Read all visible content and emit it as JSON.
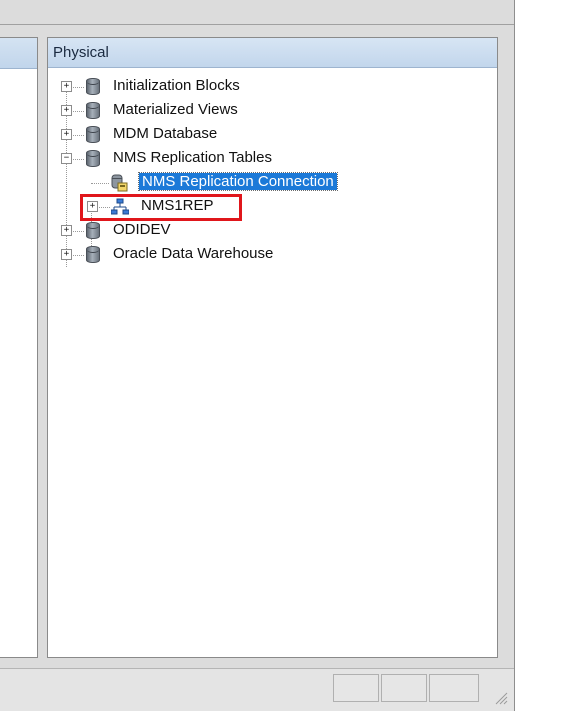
{
  "physical_pane": {
    "title": "Physical",
    "tree": [
      {
        "label": "Initialization Blocks",
        "icon": "database-icon",
        "expander": "+"
      },
      {
        "label": "Materialized Views",
        "icon": "database-icon",
        "expander": "+"
      },
      {
        "label": "MDM Database",
        "icon": "database-icon",
        "expander": "+"
      },
      {
        "label": "NMS Replication Tables",
        "icon": "database-icon",
        "expander": "−"
      },
      {
        "label": "NMS Replication Connection",
        "icon": "connection-pool-icon",
        "selected": true
      },
      {
        "label": "NMS1REP",
        "icon": "physical-schema-icon",
        "expander": "+",
        "highlighted": true
      },
      {
        "label": "ODIDEV",
        "icon": "database-icon",
        "expander": "+"
      },
      {
        "label": "Oracle Data Warehouse",
        "icon": "database-icon",
        "expander": "+"
      }
    ]
  },
  "colors": {
    "selection": "#1b79d8",
    "highlight_box": "#e0161b",
    "header_gradient": "#c2d6ec"
  }
}
